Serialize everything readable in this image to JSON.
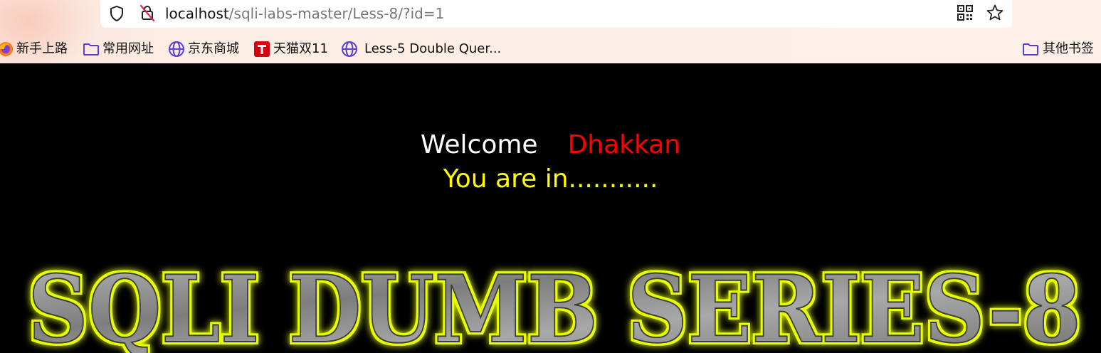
{
  "browser": {
    "url_host": "localhost",
    "url_path": "/sqli-labs-master/Less-8/?id=1",
    "icons": [
      "shield-icon",
      "lock-slash-icon",
      "qr-code-icon",
      "star-icon"
    ]
  },
  "bookmarks": [
    {
      "label": "新手上路",
      "icon": "firefox-icon"
    },
    {
      "label": "常用网址",
      "icon": "folder-icon"
    },
    {
      "label": "京东商城",
      "icon": "globe-icon"
    },
    {
      "label": "天猫双11",
      "icon": "tmall-icon"
    },
    {
      "label": "Less-5 Double Quer...",
      "icon": "globe-icon"
    },
    {
      "label": "其他书签",
      "icon": "folder-icon"
    }
  ],
  "page": {
    "welcome": "Welcome",
    "user_name": "Dhakkan",
    "status": "You are in...........",
    "banner": "SQLI DUMB SERIES-8"
  },
  "colors": {
    "background": "#000000",
    "welcome": "#ffffff",
    "name": "#ff0000",
    "status": "#ffff00",
    "banner_glow": "#e8ff00",
    "banner_fill": "#8f8f8f",
    "icon_purple": "#5b3fd6"
  }
}
